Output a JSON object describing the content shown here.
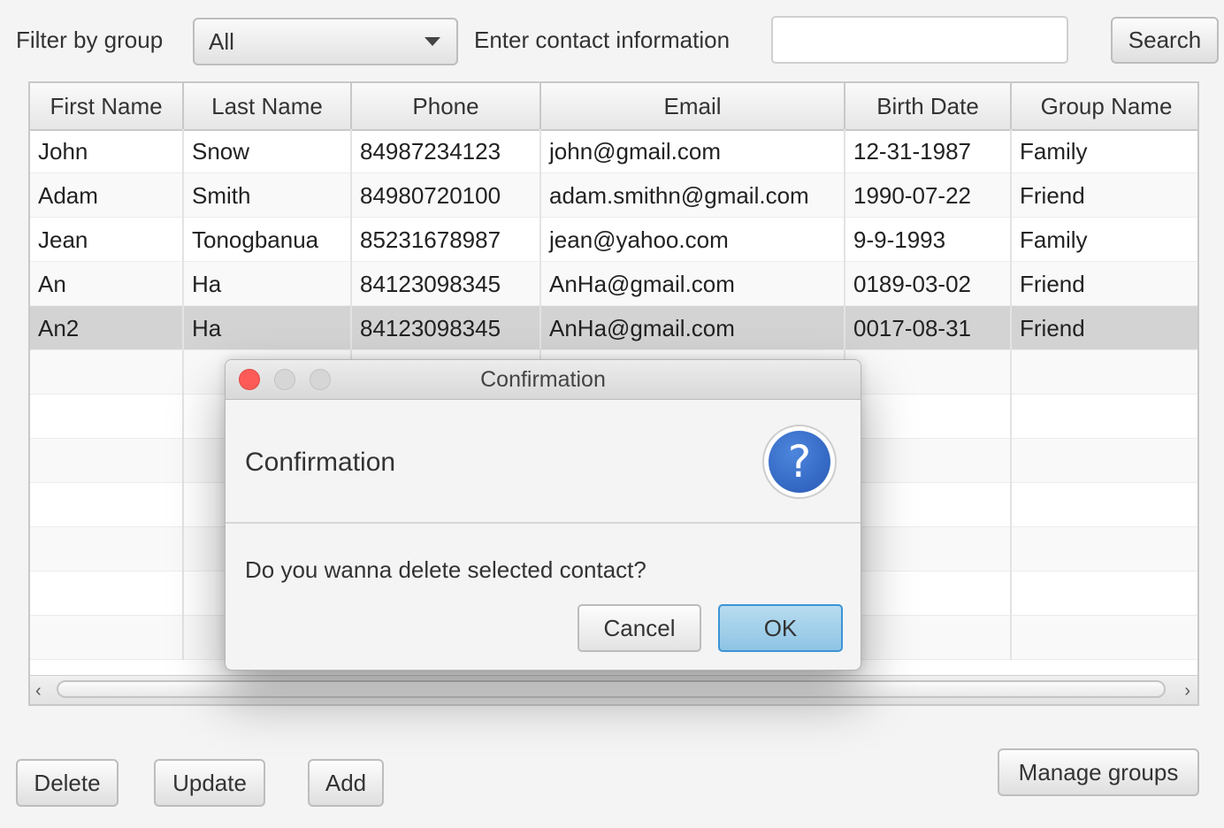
{
  "toolbar": {
    "filter_label": "Filter by group",
    "filter_value": "All",
    "contact_label": "Enter contact information",
    "contact_value": "",
    "search_label": "Search"
  },
  "table": {
    "columns": [
      "First Name",
      "Last Name",
      "Phone",
      "Email",
      "Birth Date",
      "Group Name"
    ],
    "rows": [
      [
        "John",
        "Snow",
        "84987234123",
        "john@gmail.com",
        "12-31-1987",
        "Family"
      ],
      [
        "Adam",
        "Smith",
        "84980720100",
        "adam.smithn@gmail.com",
        "1990-07-22",
        "Friend"
      ],
      [
        "Jean",
        "Tonogbanua",
        "85231678987",
        "jean@yahoo.com",
        "9-9-1993",
        "Family"
      ],
      [
        "An",
        "Ha",
        "84123098345",
        "AnHa@gmail.com",
        "0189-03-02",
        "Friend"
      ],
      [
        "An2",
        "Ha",
        "84123098345",
        "AnHa@gmail.com",
        "0017-08-31",
        "Friend"
      ]
    ],
    "selected_row": 4
  },
  "dialog": {
    "window_title": "Confirmation",
    "header": "Confirmation",
    "icon": "question-icon",
    "message": "Do you wanna delete selected contact?",
    "cancel_label": "Cancel",
    "ok_label": "OK"
  },
  "actions": {
    "delete_label": "Delete",
    "update_label": "Update",
    "add_label": "Add",
    "manage_groups_label": "Manage groups"
  },
  "colors": {
    "selected_row": "#d3d3d3",
    "ok_button": "#a6d2ec",
    "close_button": "#fc5b57",
    "question_icon": "#3367c4"
  }
}
